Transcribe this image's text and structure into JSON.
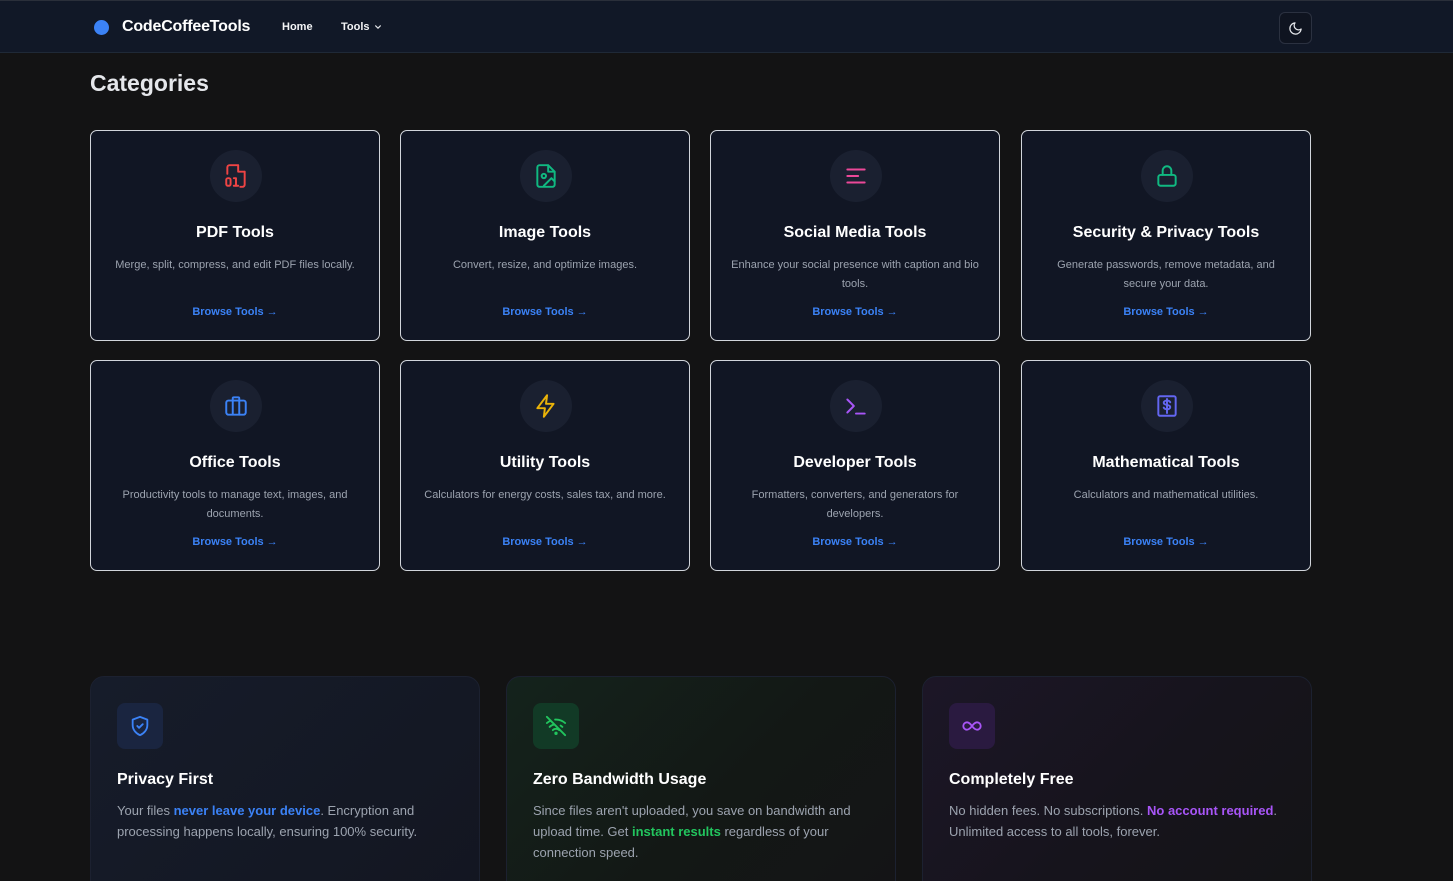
{
  "header": {
    "brand": "CodeCoffeeTools",
    "nav": {
      "home": "Home",
      "tools": "Tools"
    },
    "icons": {
      "brand": "blue-dot-logo",
      "tools_dropdown": "chevron-down-icon",
      "theme_toggle": "moon-icon"
    }
  },
  "categories": {
    "heading": "Categories",
    "items": [
      {
        "title": "PDF Tools",
        "description": "Merge, split, compress, and edit PDF files locally.",
        "link": "Browse Tools →",
        "icon": "pdf-file-icon",
        "color": "#ef4444"
      },
      {
        "title": "Image Tools",
        "description": "Convert, resize, and optimize images.",
        "link": "Browse Tools →",
        "icon": "image-file-icon",
        "color": "#10b981"
      },
      {
        "title": "Social Media Tools",
        "description": "Enhance your social presence with caption and bio tools.",
        "link": "Browse Tools →",
        "icon": "text-lines-icon",
        "color": "#ec4899"
      },
      {
        "title": "Security & Privacy Tools",
        "description": "Generate passwords, remove metadata, and secure your data.",
        "link": "Browse Tools →",
        "icon": "lock-icon",
        "color": "#10b981"
      },
      {
        "title": "Office Tools",
        "description": "Productivity tools to manage text, images, and documents.",
        "link": "Browse Tools →",
        "icon": "briefcase-icon",
        "color": "#3b82f6"
      },
      {
        "title": "Utility Tools",
        "description": "Calculators for energy costs, sales tax, and more.",
        "link": "Browse Tools →",
        "icon": "lightning-icon",
        "color": "#eab308"
      },
      {
        "title": "Developer Tools",
        "description": "Formatters, converters, and generators for developers.",
        "link": "Browse Tools →",
        "icon": "terminal-icon",
        "color": "#a855f7"
      },
      {
        "title": "Mathematical Tools",
        "description": "Calculators and mathematical utilities.",
        "link": "Browse Tools →",
        "icon": "dollar-receipt-icon",
        "color": "#6366f1"
      }
    ]
  },
  "features": [
    {
      "title": "Privacy First",
      "icon": "shield-check-icon",
      "color": "#3b82f6",
      "text_before": "Your files ",
      "highlight": "never leave your device",
      "text_after": ". Encryption and processing happens locally, ensuring 100% security."
    },
    {
      "title": "Zero Bandwidth Usage",
      "icon": "wifi-off-icon",
      "color": "#22c55e",
      "text_before": "Since files aren't uploaded, you save on bandwidth and upload time. Get ",
      "highlight": "instant results",
      "text_after": " regardless of your connection speed."
    },
    {
      "title": "Completely Free",
      "icon": "infinity-icon",
      "color": "#a855f7",
      "text_before": "No hidden fees. No subscriptions. ",
      "highlight": "No account required",
      "text_after": ". Unlimited access to all tools, forever."
    }
  ]
}
